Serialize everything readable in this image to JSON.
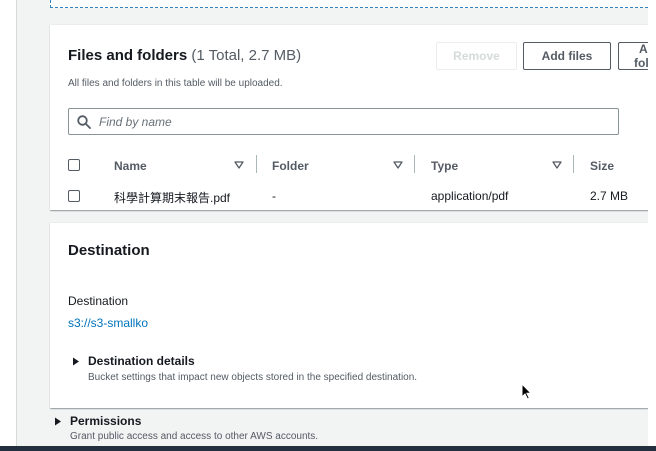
{
  "files_panel": {
    "title": "Files and folders",
    "count": "(1 Total, 2.7 MB)",
    "description": "All files and folders in this table will be uploaded.",
    "buttons": {
      "remove": "Remove",
      "add_files": "Add files",
      "add_folder": "Add folder"
    },
    "search": {
      "placeholder": "Find by name",
      "value": ""
    },
    "columns": [
      "Name",
      "Folder",
      "Type",
      "Size"
    ],
    "rows": [
      {
        "name": "科學計算期末報告.pdf",
        "folder": "-",
        "type": "application/pdf",
        "size": "2.7 MB",
        "checked": false
      }
    ]
  },
  "destination_panel": {
    "title": "Destination",
    "label": "Destination",
    "link": "s3://s3-smallko",
    "details": {
      "label": "Destination details",
      "description": "Bucket settings that impact new objects stored in the specified destination."
    }
  },
  "permissions": {
    "label": "Permissions",
    "description": "Grant public access and access to other AWS accounts."
  },
  "colors": {
    "link": "#0073bb",
    "text": "#16191f",
    "muted": "#545b64",
    "background": "#f2f3f3"
  }
}
